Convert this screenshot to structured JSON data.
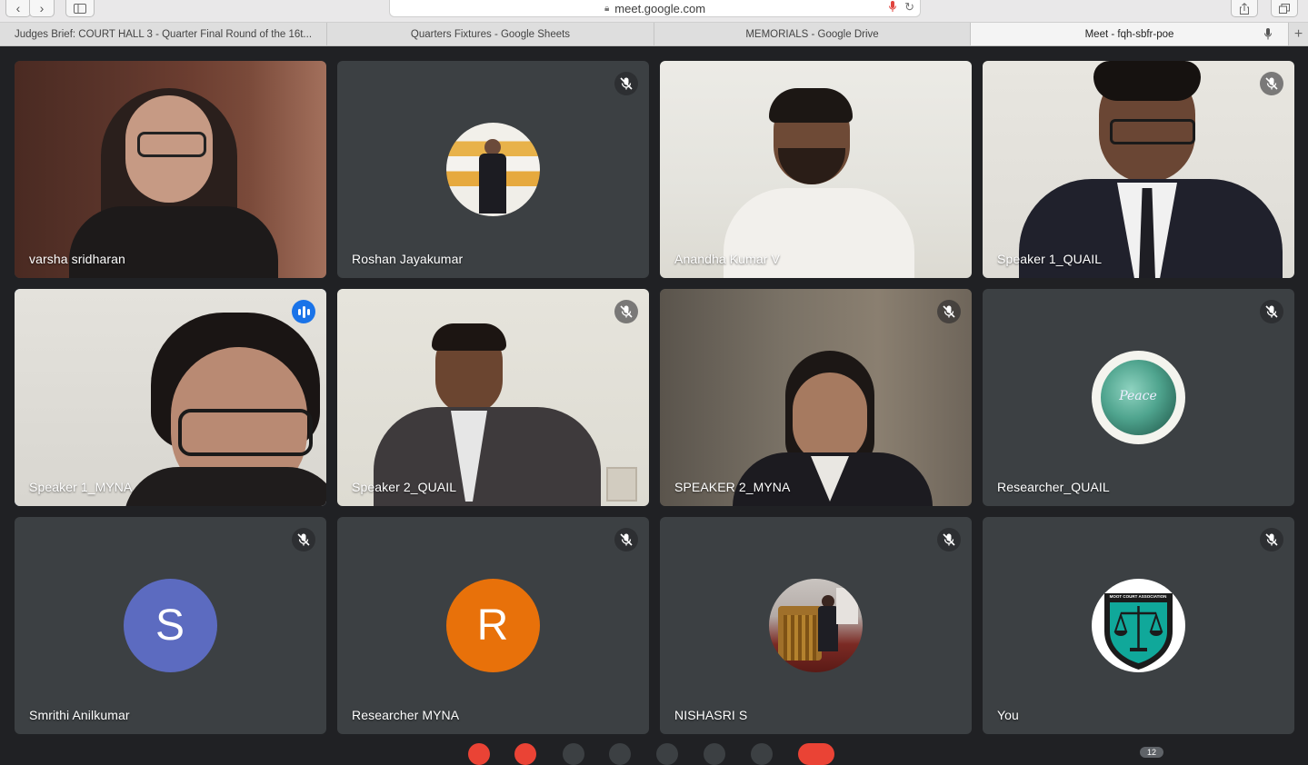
{
  "browser": {
    "url": "meet.google.com",
    "tabs": [
      {
        "label": "Judges Brief: COURT HALL 3 - Quarter Final Round of the 16t..."
      },
      {
        "label": "Quarters Fixtures - Google Sheets"
      },
      {
        "label": "MEMORIALS - Google Drive"
      },
      {
        "label": "Meet - fqh-sbfr-poe"
      }
    ]
  },
  "participants": [
    {
      "name": "varsha sridharan",
      "muted": false
    },
    {
      "name": "Roshan Jayakumar",
      "muted": true
    },
    {
      "name": "Anandha Kumar V",
      "muted": false
    },
    {
      "name": "Speaker 1_QUAIL",
      "muted": true
    },
    {
      "name": "Speaker 1_MYNA",
      "speaking": true
    },
    {
      "name": "Speaker 2_QUAIL",
      "muted": true
    },
    {
      "name": "SPEAKER 2_MYNA",
      "muted": true
    },
    {
      "name": "Researcher_QUAIL",
      "muted": true
    },
    {
      "name": "Smrithi Anilkumar",
      "muted": true,
      "initial": "S",
      "color": "#5c6bc0"
    },
    {
      "name": "Researcher MYNA",
      "muted": true,
      "initial": "R",
      "color": "#e8710a"
    },
    {
      "name": "NISHASRI S",
      "muted": true
    },
    {
      "name": "You",
      "muted": true
    }
  ],
  "avatar_texts": {
    "researcher_quail": "Peace",
    "you_logo": "MOOT COURT ASSOCIATION"
  },
  "participant_count": "12",
  "colors": {
    "background": "#202124",
    "tile": "#3c4043",
    "speaking_border": "#8ab4f8",
    "speaking_badge": "#1a73e8"
  }
}
